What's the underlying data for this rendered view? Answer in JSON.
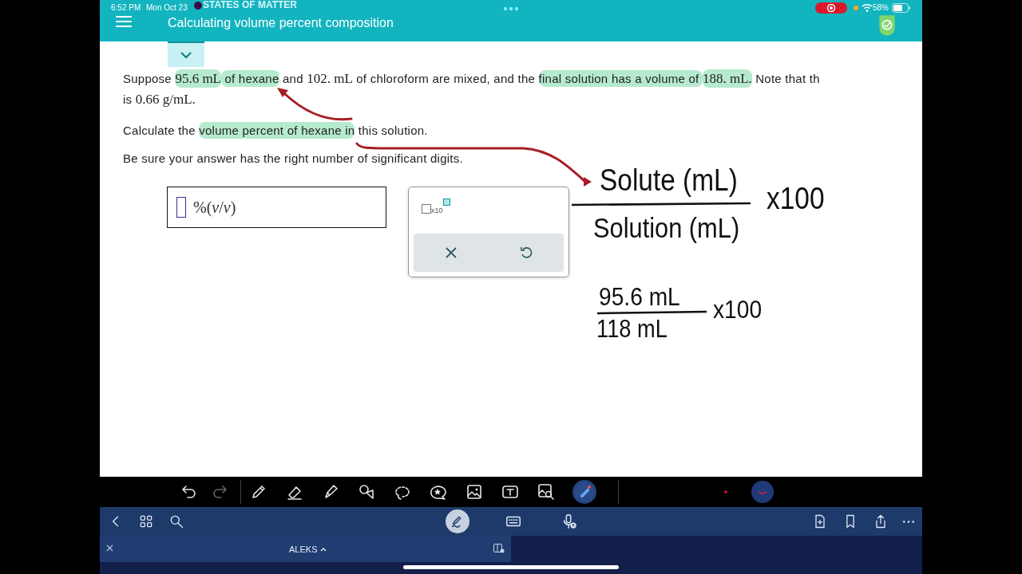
{
  "top_bar": {
    "status_time": "6:52 PM",
    "status_date": "Mon Oct 23",
    "battery_percent": "58%",
    "topic": "STATES OF MATTER",
    "title": "Calculating volume percent composition"
  },
  "question": {
    "lines": [
      [
        {
          "text": "Suppose ",
          "math": false,
          "highlighted": false
        },
        {
          "text": "95.6 mL",
          "math": true,
          "highlighted": true
        },
        {
          "text": " of hexane",
          "math": false,
          "highlighted": true
        },
        {
          "text": " and ",
          "math": false,
          "highlighted": false
        },
        {
          "text": "102. mL",
          "math": true,
          "highlighted": false
        },
        {
          "text": " of chloroform are mixed, and the ",
          "math": false,
          "highlighted": false
        },
        {
          "text": "final solution has a volume of ",
          "math": false,
          "highlighted": true
        },
        {
          "text": "188. mL.",
          "math": true,
          "highlighted": true
        },
        {
          "text": " Note that th",
          "math": false,
          "highlighted": false
        }
      ],
      [
        {
          "text": "is ",
          "math": false,
          "highlighted": false
        },
        {
          "text": "0.66 g/mL.",
          "math": true,
          "highlighted": false
        }
      ],
      [
        {
          "text": "Calculate the ",
          "math": false,
          "highlighted": false
        },
        {
          "text": "volume percent of hexane in",
          "math": false,
          "highlighted": true
        },
        {
          "text": " this solution.",
          "math": false,
          "highlighted": false
        }
      ],
      [
        {
          "text": "Be sure your answer has the right number of significant digits.",
          "math": false,
          "highlighted": false
        }
      ]
    ]
  },
  "answer": {
    "unit": "%(*v*/*v*)"
  },
  "keypad": {
    "exponent_label": "x10"
  },
  "annotations": [
    {
      "numerator": "Solute (mL)",
      "denominator": "Solution (mL)",
      "factor": "x100"
    },
    {
      "numerator": "95.6 mL",
      "denominator": "118 mL",
      "factor": "x100"
    }
  ],
  "toolbar": {
    "history": [
      {
        "kind": "undo",
        "disabled": false
      },
      {
        "kind": "redo",
        "disabled": true
      }
    ],
    "tools": [
      {
        "kind": "pen",
        "selected": false
      },
      {
        "kind": "eraser",
        "selected": false
      },
      {
        "kind": "highlighter",
        "selected": false
      },
      {
        "kind": "shapes",
        "selected": false
      },
      {
        "kind": "lasso",
        "selected": false
      },
      {
        "kind": "sticker",
        "selected": false
      },
      {
        "kind": "image",
        "selected": false
      },
      {
        "kind": "text",
        "selected": false
      },
      {
        "kind": "image-search",
        "selected": false
      },
      {
        "kind": "laser",
        "selected": true
      }
    ]
  },
  "nav": {
    "modes": [
      {
        "kind": "pen",
        "selected": true
      },
      {
        "kind": "keyboard",
        "selected": false
      },
      {
        "kind": "dictation",
        "selected": false
      }
    ]
  },
  "tab_strip": {
    "tab": "ALEKS"
  }
}
